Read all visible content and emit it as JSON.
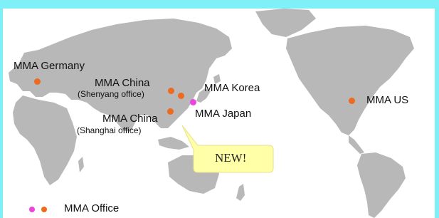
{
  "offices": [
    {
      "name": "MMA Germany",
      "sub": ""
    },
    {
      "name": "MMA China",
      "sub": "(Shenyang office)"
    },
    {
      "name": "MMA Korea",
      "sub": ""
    },
    {
      "name": "MMA Japan",
      "sub": ""
    },
    {
      "name": "MMA China",
      "sub": "(Shanghai office)"
    },
    {
      "name": "MMA US",
      "sub": ""
    }
  ],
  "callout": {
    "text": "NEW!"
  },
  "legend": {
    "label": "MMA Office"
  },
  "colors": {
    "border": "#7ff0f8",
    "land": "#b8b8b8",
    "office_dot": "#ee6a1e",
    "new_office_dot": "#ee44dd",
    "callout_bg": "#ffffa8"
  }
}
